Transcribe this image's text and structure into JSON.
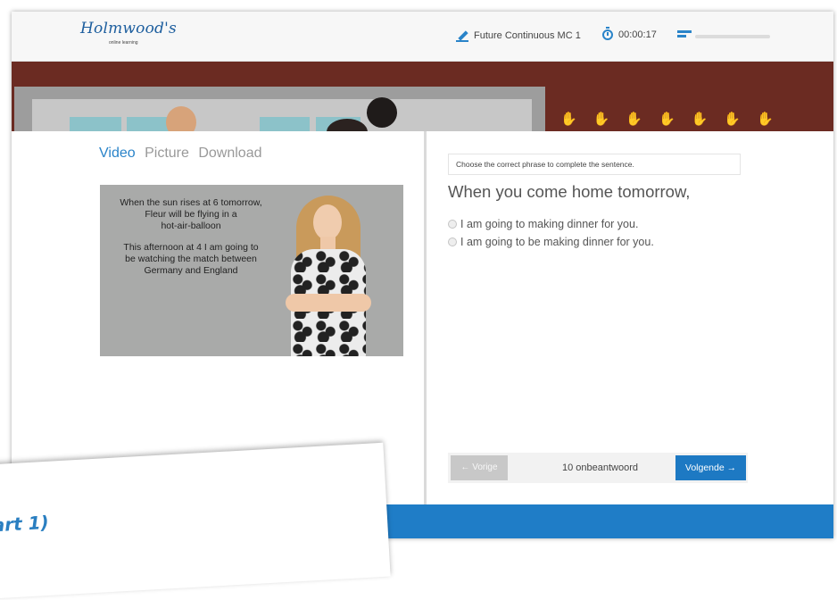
{
  "header": {
    "logo_text": "Holmwood's",
    "logo_subtext": "online learning",
    "exercise_title": "Future Continuous MC 1",
    "timer": "00:00:17",
    "progress_fraction": 0.0
  },
  "tabs": [
    {
      "label": "Video"
    },
    {
      "label": "Picture"
    },
    {
      "label": "Download"
    }
  ],
  "video": {
    "caption_1": "When the sun rises at 6 tomorrow,\nFleur will be flying in a\nhot-air-balloon",
    "caption_2": "This afternoon at 4 I am going to\nbe watching the match between\nGermany and England"
  },
  "question": {
    "instruction": "Choose the correct phrase to complete the sentence.",
    "prompt": "When you come home tomorrow,",
    "options": [
      {
        "label": "I am going to making dinner for you."
      },
      {
        "label": "I am going to be making dinner for you."
      }
    ]
  },
  "navigation": {
    "prev_label": "← Vorige",
    "status": "10 onbeantwoord",
    "next_label": "Volgende →"
  },
  "overlay": {
    "doc_text": "art 1)"
  },
  "colors": {
    "accent": "#2a84c9",
    "banner": "#6b2b22",
    "footer": "#1f7dc7",
    "next_button": "#1d79c3"
  }
}
